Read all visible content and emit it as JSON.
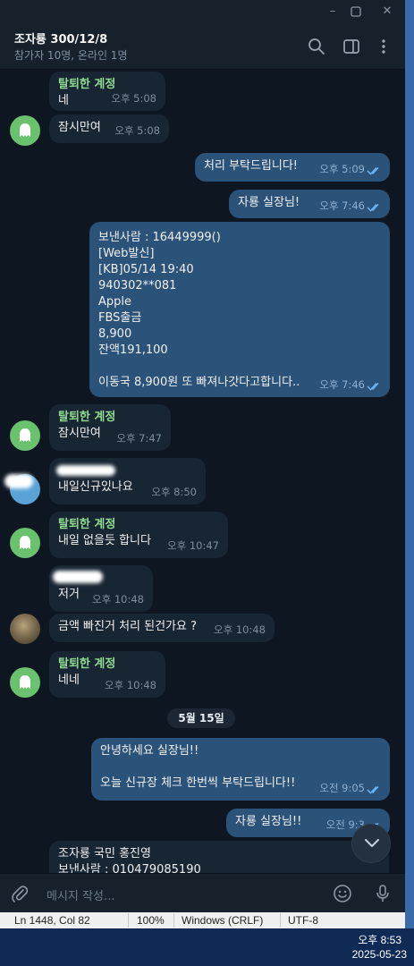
{
  "window": {
    "minimize_icon": "minimize-icon",
    "maximize_icon": "maximize-icon",
    "close_icon": "close-icon"
  },
  "header": {
    "title": "조자룡 300/12/8",
    "subtitle": "참가자 10명, 온라인 1명"
  },
  "messages": [
    {
      "sender": "탈퇴한 계정",
      "text": "네",
      "time": "오후 5:08"
    },
    {
      "text": "잠시만여",
      "time": "오후 5:08"
    },
    {
      "text": "처리 부탁드립니다!",
      "time": "오후 5:09"
    },
    {
      "text": "자룡 실장님!",
      "time": "오후 7:46"
    },
    {
      "text": "보낸사람 : 16449999()\n[Web발신]\n[KB]05/14 19:40\n940302**081\nApple\nFBS출금\n8,900\n잔액191,100\n\n이동국 8,900원 또 빠져나갓다고합니다..",
      "time": "오후 7:46"
    },
    {
      "sender": "탈퇴한 계정",
      "text": "잠시만여",
      "time": "오후 7:47"
    },
    {
      "text": "내일신규있나요",
      "time": "오후 8:50"
    },
    {
      "sender": "탈퇴한 계정",
      "text": "내일 없을듯 합니다",
      "time": "오후 10:47"
    },
    {
      "text": "저거",
      "time": "오후 10:48"
    },
    {
      "text": "금액 빠진거 처리 된건가요 ?",
      "time": "오후 10:48"
    },
    {
      "sender": "탈퇴한 계정",
      "text": "네네",
      "time": "오후 10:48"
    },
    {
      "text": "안녕하세요 실장님!!\n\n오늘 신규장 체크 한번씩 부탁드립니다!!",
      "time": "오전 9:05"
    },
    {
      "text": "자룡 실장님!!",
      "time": "오전 9:3"
    },
    {
      "text": "조자룡 국민 홍진영\n보낸사람 : 010479085190"
    }
  ],
  "date_divider": "5월 15일",
  "composer": {
    "placeholder": "메시지 작성..."
  },
  "statusbar": {
    "position": "Ln 1448, Col 82",
    "zoom": "100%",
    "line_ending": "Windows (CRLF)",
    "encoding": "UTF-8"
  },
  "taskbar": {
    "time": "오후 8:53",
    "date": "2025-05-23"
  },
  "colors": {
    "background": "#0e1621",
    "incoming_bubble": "#182533",
    "outgoing_bubble": "#2b5278",
    "sender_name": "#8fdc8f",
    "read_ticks": "#6ab3f3"
  }
}
